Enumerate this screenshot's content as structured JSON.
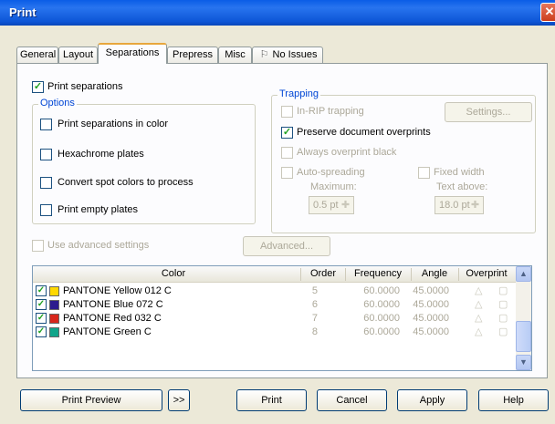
{
  "window": {
    "title": "Print",
    "close_symbol": "✕"
  },
  "tabs": [
    {
      "label": "General"
    },
    {
      "label": "Layout"
    },
    {
      "label": "Separations"
    },
    {
      "label": "Prepress"
    },
    {
      "label": "Misc"
    },
    {
      "label": "No Issues",
      "icon": "issues-icon"
    }
  ],
  "separations": {
    "print_separations": {
      "label": "Print separations",
      "checked": true
    },
    "options": {
      "title": "Options",
      "items": [
        {
          "label": "Print separations in color",
          "checked": false
        },
        {
          "label": "Hexachrome plates",
          "checked": false
        },
        {
          "label": "Convert spot colors to process",
          "checked": false
        },
        {
          "label": "Print empty plates",
          "checked": false
        }
      ]
    },
    "trapping": {
      "title": "Trapping",
      "in_rip": {
        "label": "In-RIP trapping",
        "checked": false,
        "enabled": false
      },
      "settings_button": "Settings...",
      "preserve": {
        "label": "Preserve document overprints",
        "checked": true
      },
      "always_overprint": {
        "label": "Always overprint black",
        "checked": false,
        "enabled": false
      },
      "auto_spreading": {
        "label": "Auto-spreading",
        "checked": false,
        "enabled": false
      },
      "fixed_width": {
        "label": "Fixed width",
        "checked": false,
        "enabled": false
      },
      "maximum_label": "Maximum:",
      "maximum_value": "0.5 pt",
      "text_above_label": "Text above:",
      "text_above_value": "18.0 pt"
    },
    "advanced": {
      "label": "Use advanced settings",
      "checked": false,
      "button": "Advanced..."
    },
    "table": {
      "headers": [
        "Color",
        "Order",
        "Frequency",
        "Angle",
        "Overprint"
      ],
      "rows": [
        {
          "checked": true,
          "swatch": "#ffd800",
          "name": "PANTONE Yellow 012 C",
          "order": "5",
          "frequency": "60.0000",
          "angle": "45.0000"
        },
        {
          "checked": true,
          "swatch": "#2b1c8e",
          "name": "PANTONE Blue 072 C",
          "order": "6",
          "frequency": "60.0000",
          "angle": "45.0000"
        },
        {
          "checked": true,
          "swatch": "#d8261c",
          "name": "PANTONE Red 032 C",
          "order": "7",
          "frequency": "60.0000",
          "angle": "45.0000"
        },
        {
          "checked": true,
          "swatch": "#10a58a",
          "name": "PANTONE Green C",
          "order": "8",
          "frequency": "60.0000",
          "angle": "45.0000"
        }
      ]
    }
  },
  "footer": {
    "print_preview": "Print Preview",
    "preview_toggle": ">>",
    "print": "Print",
    "cancel": "Cancel",
    "apply": "Apply",
    "help": "Help"
  }
}
